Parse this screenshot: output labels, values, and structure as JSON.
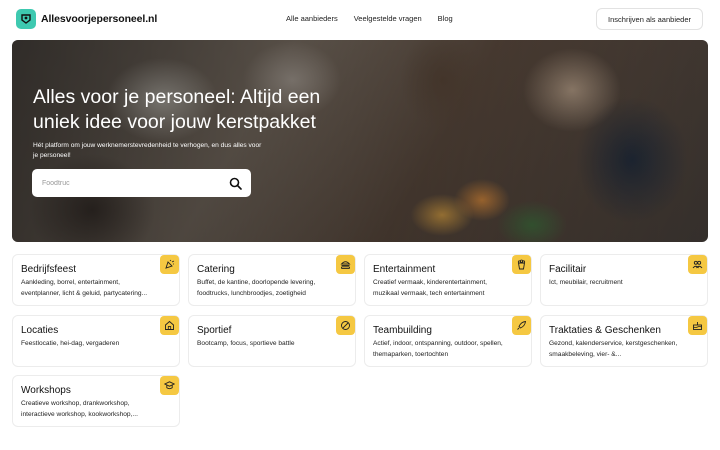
{
  "header": {
    "logo_text": "Allesvoorjepersoneel.nl",
    "nav": [
      "Alle aanbieders",
      "Veelgestelde vragen",
      "Blog"
    ],
    "signup_label": "Inschrijven als aanbieder"
  },
  "hero": {
    "title": "Alles voor je personeel: Altijd een uniek idee voor jouw kerstpakket",
    "subtitle": "Hét platform om jouw werknemerstevredenheid te verhogen, en dus alles voor je personeel!",
    "search_placeholder": "Foodtruc",
    "search_value": ""
  },
  "categories": [
    {
      "title": "Bedrijfsfeest",
      "desc": "Aankleding, borrel, entertainment, eventplanner, licht & geluid, partycatering...",
      "icon": "party-popper-icon"
    },
    {
      "title": "Catering",
      "desc": "Buffet, de kantine, doorlopende levering, foodtrucks, lunchbroodjes, zoetigheid",
      "icon": "burger-icon"
    },
    {
      "title": "Entertainment",
      "desc": "Creatief vermaak, kinderentertainment, muzikaal vermaak, tech entertainment",
      "icon": "popcorn-icon"
    },
    {
      "title": "Facilitair",
      "desc": "Ict, meubilair, recruitment",
      "icon": "people-icon"
    },
    {
      "title": "Locaties",
      "desc": "Feestlocatie, hei-dag, vergaderen",
      "icon": "building-icon"
    },
    {
      "title": "Sportief",
      "desc": "Bootcamp, focus, sportieve battle",
      "icon": "ball-icon"
    },
    {
      "title": "Teambuilding",
      "desc": "Actief, indoor, ontspanning, outdoor, spellen, themaparken, toertochten",
      "icon": "rocket-icon"
    },
    {
      "title": "Traktaties & Geschenken",
      "desc": "Gezond, kalenderservice, kerstgeschenken, smaakbeleving, vier- &...",
      "icon": "cake-icon"
    },
    {
      "title": "Workshops",
      "desc": "Creatieve workshop, drankworkshop, interactieve workshop, kookworkshop,...",
      "icon": "graduation-cap-icon"
    }
  ],
  "colors": {
    "accent": "#f5c842",
    "logo": "#3ec9b0"
  }
}
